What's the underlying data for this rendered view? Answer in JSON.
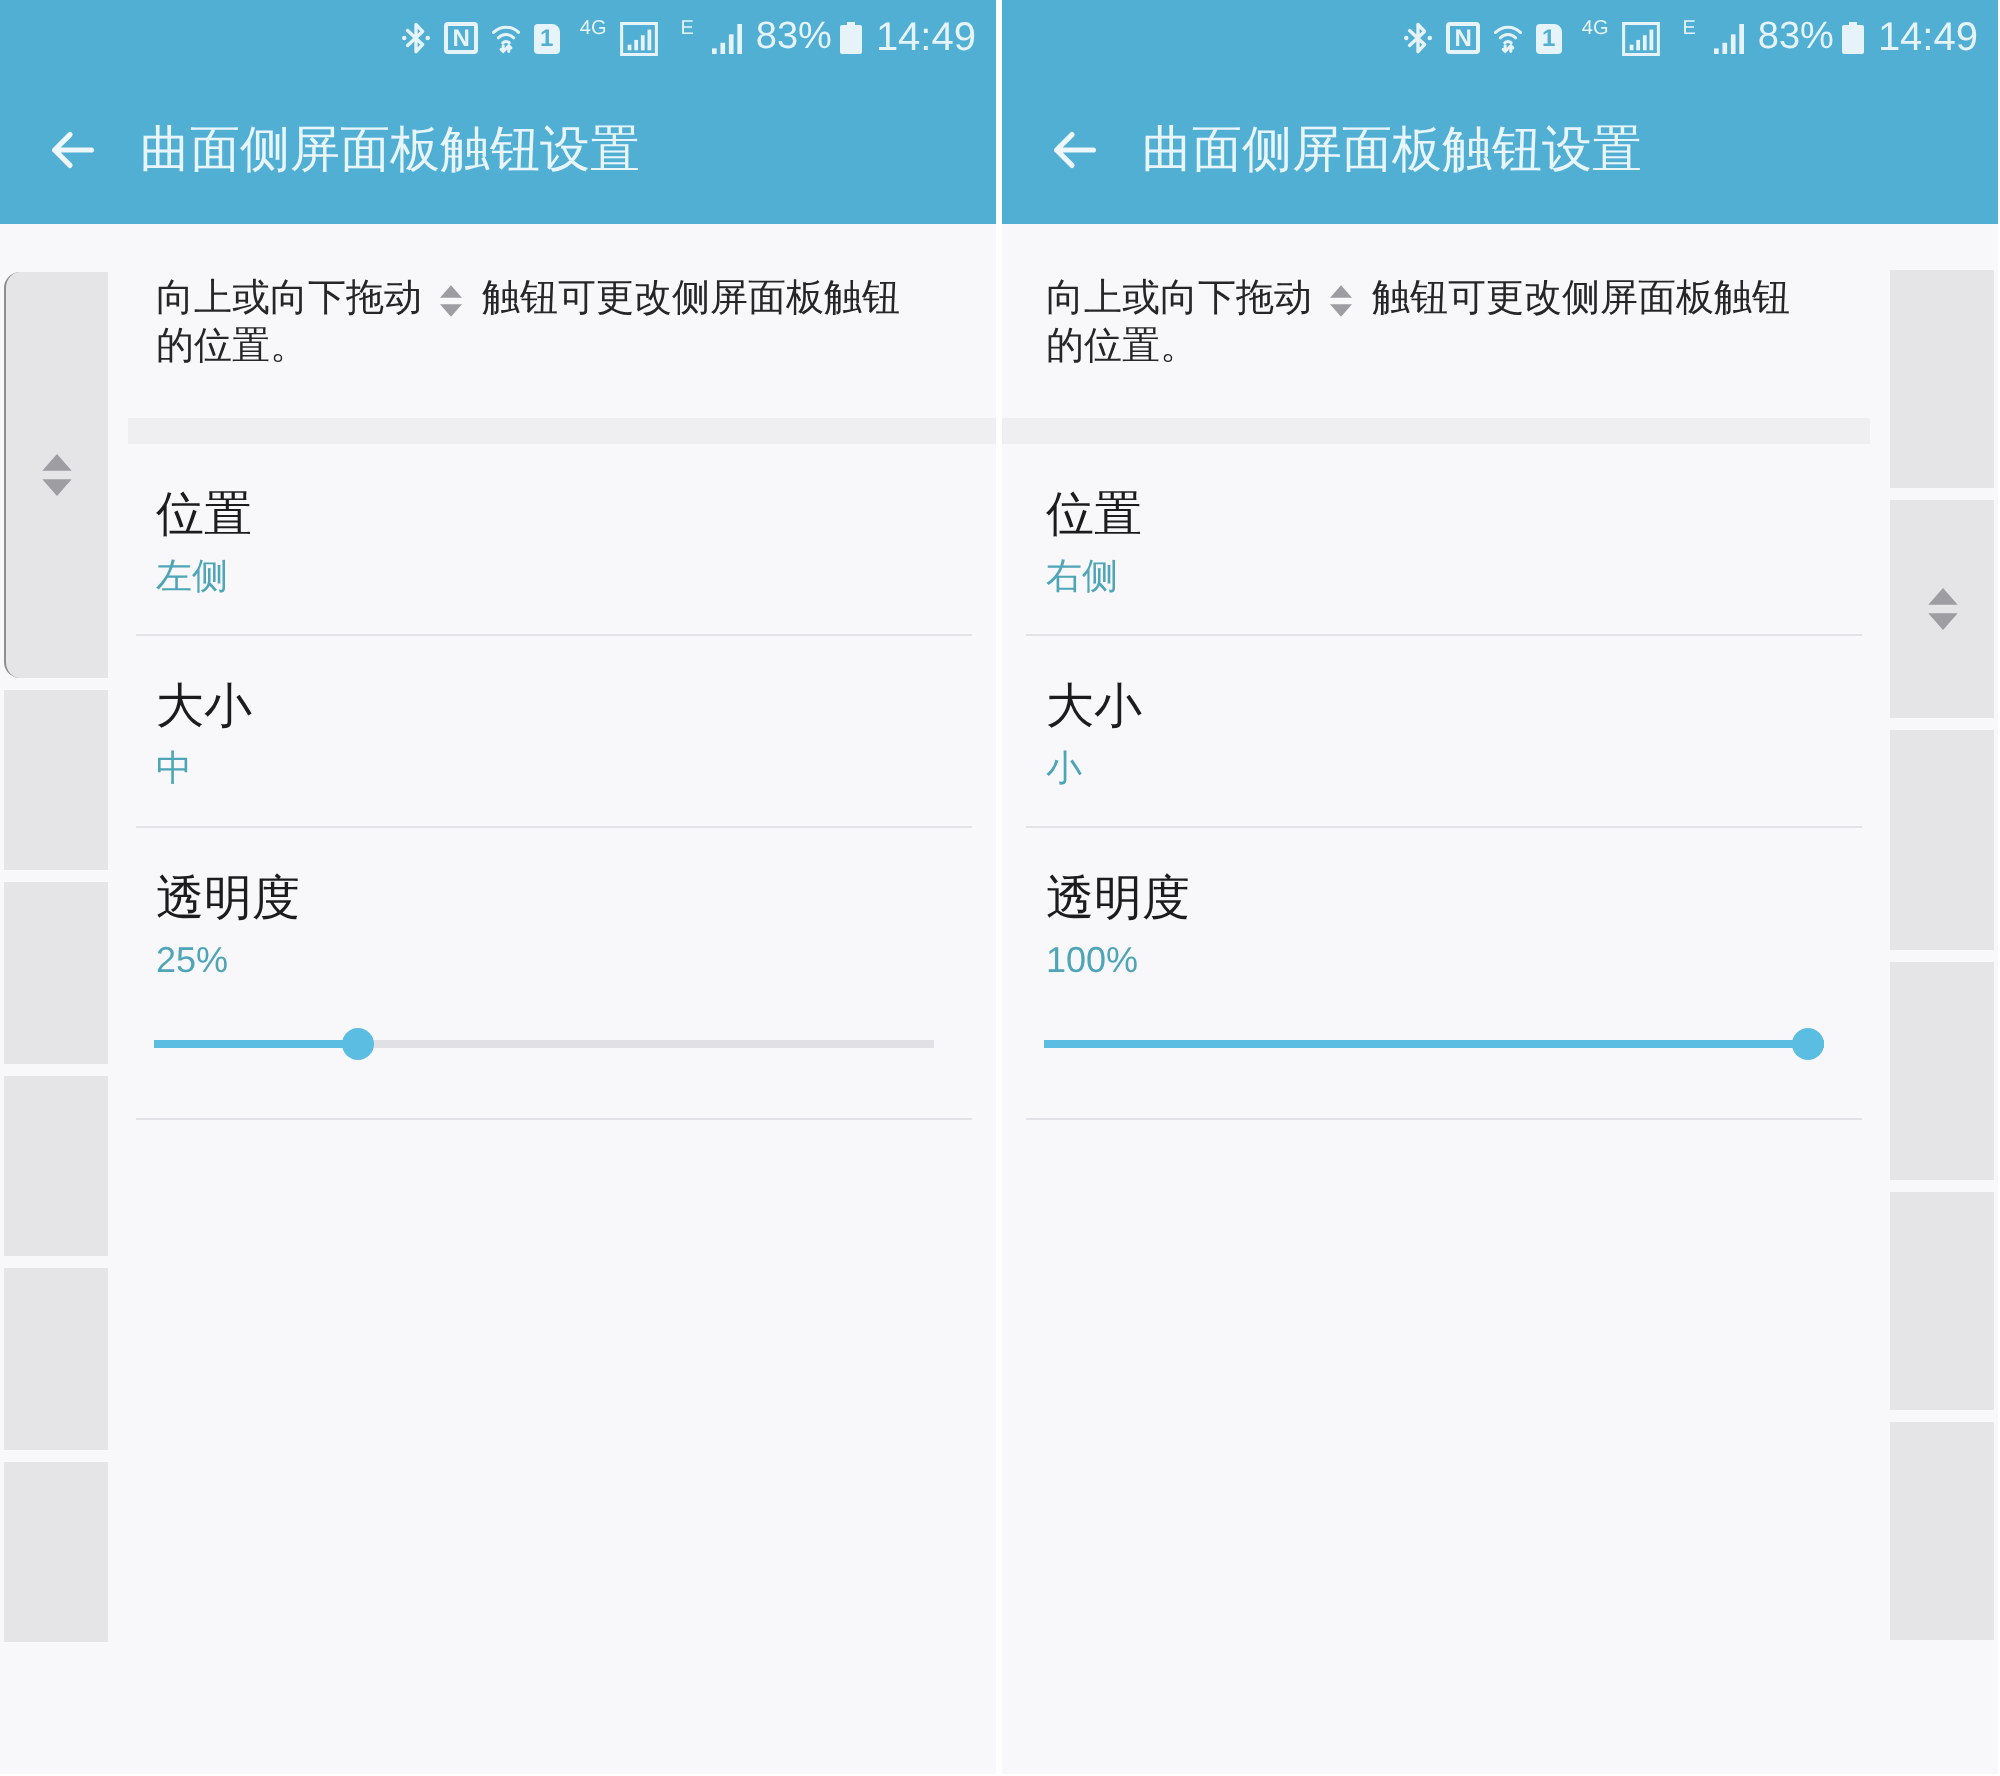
{
  "screens": [
    {
      "status_bar": {
        "nfc": "N",
        "sim": "1",
        "network_1": "4G",
        "network_2": "E",
        "battery": "83%",
        "time": "14:49"
      },
      "app_bar": {
        "title": "曲面侧屏面板触钮设置"
      },
      "left_edge_panel": {
        "handle_outline": true,
        "tabs": [
          {
            "kind": "tall",
            "selected": true
          },
          {
            "kind": "standard",
            "selected": false
          },
          {
            "kind": "standard",
            "selected": false
          },
          {
            "kind": "standard",
            "selected": false
          },
          {
            "kind": "standard",
            "selected": false
          },
          {
            "kind": "standard",
            "selected": false
          }
        ]
      },
      "instruction": {
        "before_icon": "向上或向下拖动",
        "after_icon": "触钮可更改侧屏面板触钮",
        "continuation": "的位置。"
      },
      "settings": [
        {
          "kind": "value",
          "title": "位置",
          "value": "左侧"
        },
        {
          "kind": "value",
          "title": "大小",
          "value": "中"
        },
        {
          "kind": "slider",
          "title": "透明度",
          "value": "25%",
          "level": 0.25
        }
      ]
    },
    {
      "status_bar": {
        "nfc": "N",
        "sim": "1",
        "network_1": "4G",
        "network_2": "E",
        "battery": "83%",
        "time": "14:49"
      },
      "app_bar": {
        "title": "曲面侧屏面板触钮设置"
      },
      "right_edge_panel": {
        "handle_outline": false,
        "tabs": [
          {
            "kind": "standard",
            "selected": false
          },
          {
            "kind": "standard",
            "selected": true
          },
          {
            "kind": "standard",
            "selected": false
          },
          {
            "kind": "standard",
            "selected": false
          },
          {
            "kind": "standard",
            "selected": false
          },
          {
            "kind": "standard",
            "selected": false
          }
        ]
      },
      "instruction": {
        "before_icon": "向上或向下拖动",
        "after_icon": "触钮可更改侧屏面板触钮",
        "continuation": "的位置。"
      },
      "settings": [
        {
          "kind": "value",
          "title": "位置",
          "value": "右侧"
        },
        {
          "kind": "value",
          "title": "大小",
          "value": "小"
        },
        {
          "kind": "slider",
          "title": "透明度",
          "value": "100%",
          "level": 1.0
        }
      ]
    }
  ]
}
